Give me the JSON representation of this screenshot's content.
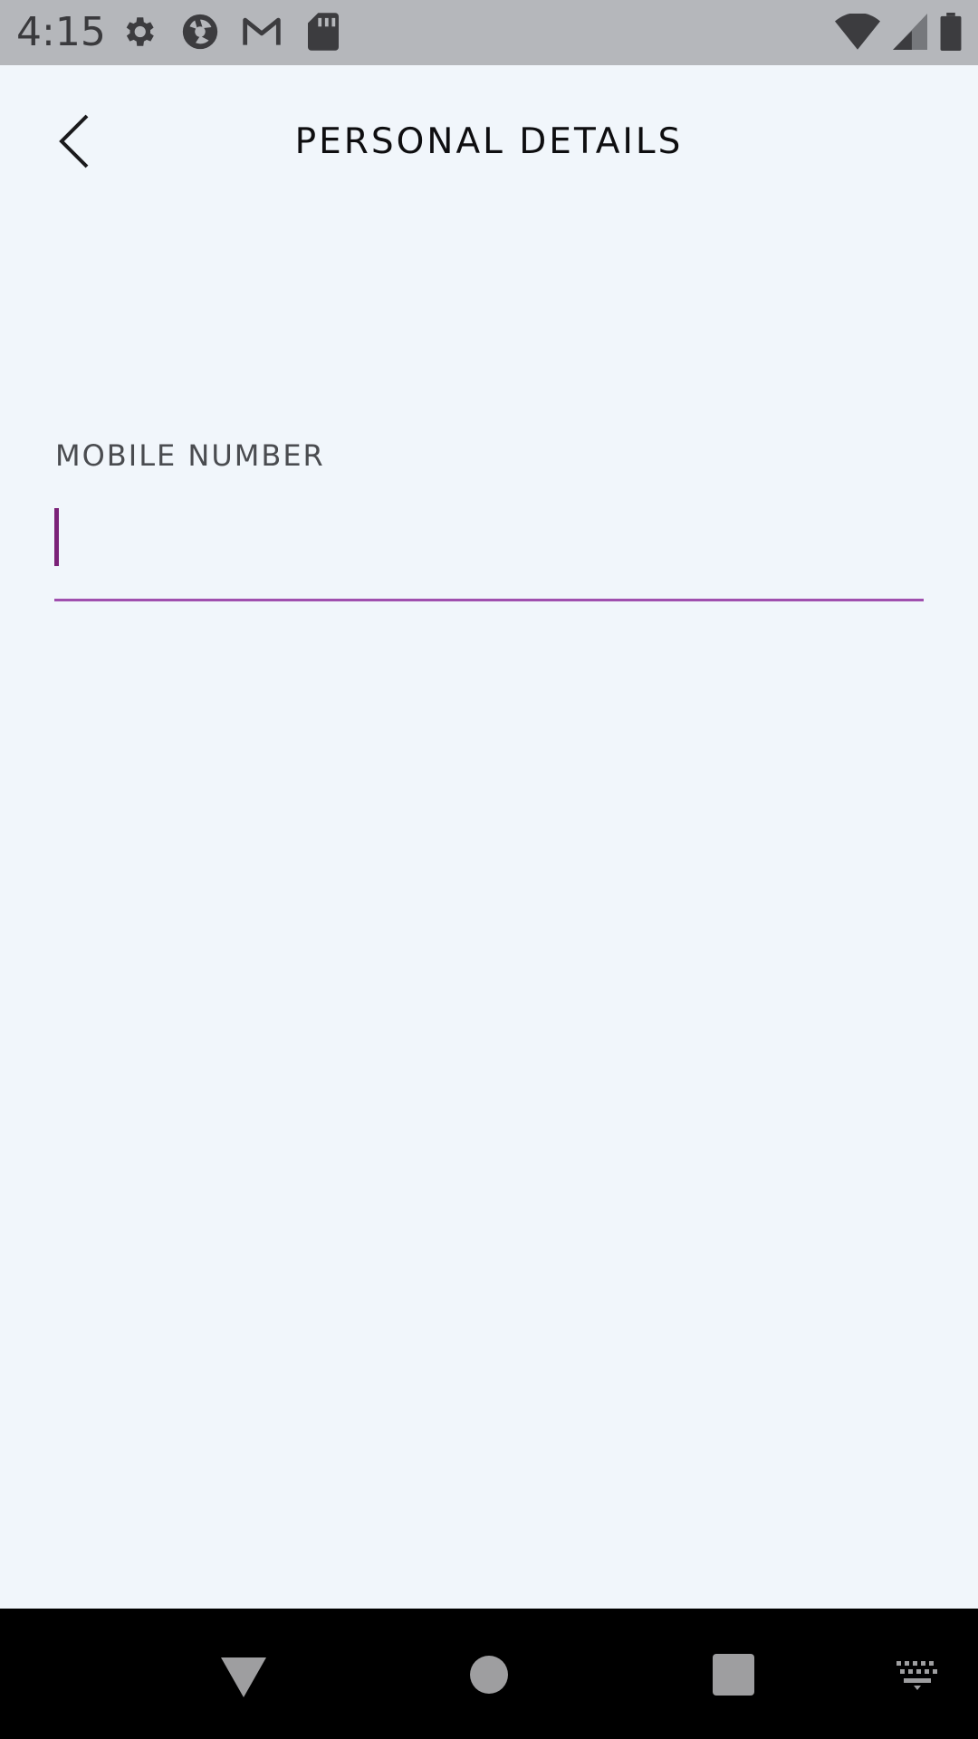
{
  "status_bar": {
    "time": "4:15",
    "left_icons": [
      "settings-icon",
      "camera-shutter-icon",
      "gmail-icon",
      "sd-card-icon"
    ],
    "right_icons": [
      "wifi-icon",
      "cellular-signal-icon",
      "battery-icon"
    ]
  },
  "app_bar": {
    "title": "PERSONAL DETAILS",
    "back_icon": "chevron-left-icon"
  },
  "form": {
    "mobile_number": {
      "label": "MOBILE NUMBER",
      "value": "",
      "placeholder": ""
    },
    "accent_color": "#a04fae",
    "caret_color": "#7b2278"
  },
  "nav_bar": {
    "buttons": [
      "back-triangle-icon",
      "home-circle-icon",
      "recents-square-icon",
      "keyboard-icon"
    ]
  }
}
